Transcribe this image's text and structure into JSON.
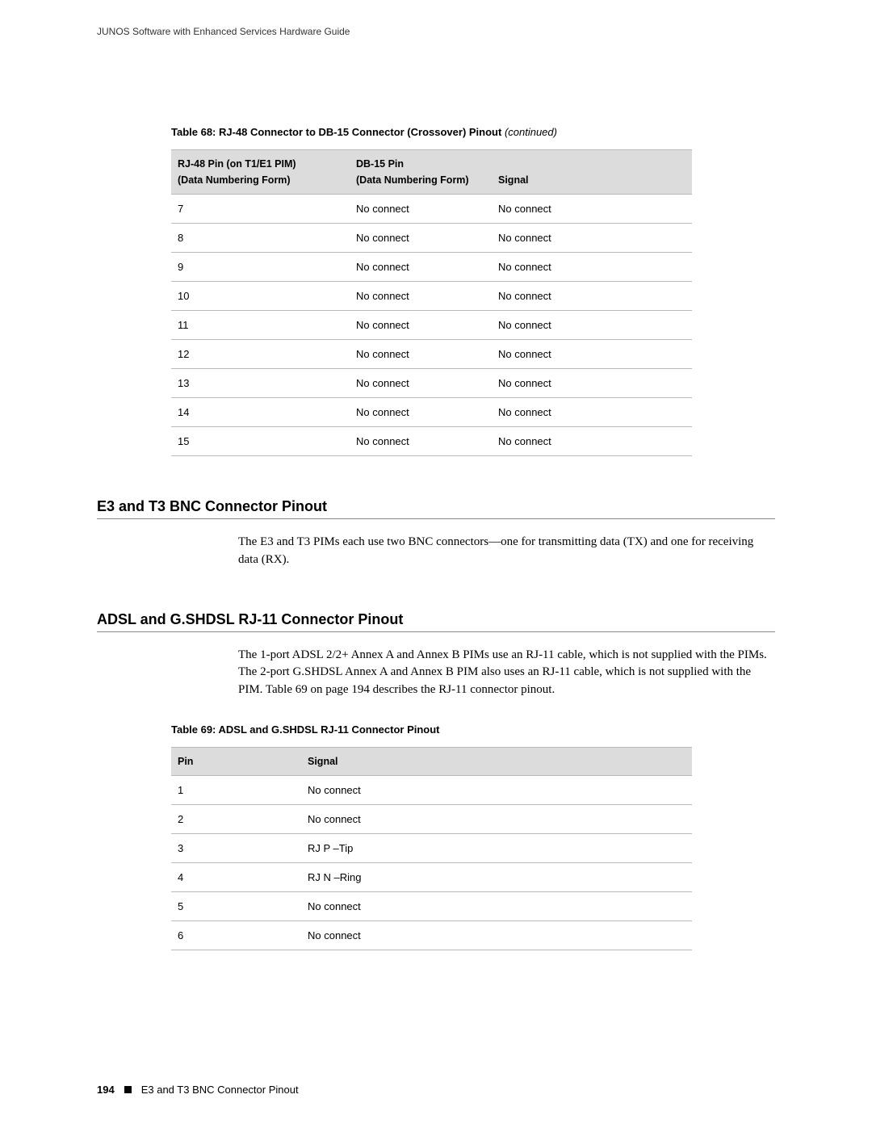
{
  "header": {
    "title": "JUNOS Software with Enhanced Services Hardware Guide"
  },
  "table68": {
    "caption_prefix": "Table 68: RJ-48 Connector to DB-15 Connector (Crossover) Pinout ",
    "caption_suffix": "(continued)",
    "headers": {
      "col1a": "RJ-48 Pin (on T1/E1 PIM)",
      "col1b": "(Data Numbering Form)",
      "col2a": "DB-15 Pin",
      "col2b": "(Data Numbering Form)",
      "col3": "Signal"
    },
    "rows": [
      {
        "c1": "7",
        "c2": "No connect",
        "c3": "No connect"
      },
      {
        "c1": "8",
        "c2": "No connect",
        "c3": "No connect"
      },
      {
        "c1": "9",
        "c2": "No connect",
        "c3": "No connect"
      },
      {
        "c1": "10",
        "c2": "No connect",
        "c3": "No connect"
      },
      {
        "c1": "11",
        "c2": "No connect",
        "c3": "No connect"
      },
      {
        "c1": "12",
        "c2": "No connect",
        "c3": "No connect"
      },
      {
        "c1": "13",
        "c2": "No connect",
        "c3": "No connect"
      },
      {
        "c1": "14",
        "c2": "No connect",
        "c3": "No connect"
      },
      {
        "c1": "15",
        "c2": "No connect",
        "c3": "No connect"
      }
    ]
  },
  "section1": {
    "heading": "E3 and T3 BNC Connector Pinout",
    "para": "The E3 and T3 PIMs each use two BNC connectors—one for transmitting data (TX) and one for receiving data (RX)."
  },
  "section2": {
    "heading": "ADSL and G.SHDSL RJ-11 Connector Pinout",
    "para": "The 1-port ADSL 2/2+ Annex A and Annex B PIMs use an RJ-11 cable, which is not supplied with the PIMs. The 2-port G.SHDSL Annex A and Annex B PIM also uses an RJ-11 cable, which is not supplied with the PIM. Table 69 on page 194 describes the RJ-11 connector pinout."
  },
  "table69": {
    "caption": "Table 69: ADSL and G.SHDSL RJ-11 Connector Pinout",
    "headers": {
      "col1": "Pin",
      "col2": "Signal"
    },
    "rows": [
      {
        "c1": "1",
        "c2": "No connect"
      },
      {
        "c1": "2",
        "c2": "No connect"
      },
      {
        "c1": "3",
        "c2": "RJ P –Tip"
      },
      {
        "c1": "4",
        "c2": "RJ N –Ring"
      },
      {
        "c1": "5",
        "c2": "No connect"
      },
      {
        "c1": "6",
        "c2": "No connect"
      }
    ]
  },
  "footer": {
    "page_number": "194",
    "section": "E3 and T3 BNC Connector Pinout"
  },
  "chart_data": [
    {
      "type": "table",
      "title": "Table 68: RJ-48 Connector to DB-15 Connector (Crossover) Pinout (continued)",
      "columns": [
        "RJ-48 Pin (on T1/E1 PIM) (Data Numbering Form)",
        "DB-15 Pin (Data Numbering Form)",
        "Signal"
      ],
      "rows": [
        [
          "7",
          "No connect",
          "No connect"
        ],
        [
          "8",
          "No connect",
          "No connect"
        ],
        [
          "9",
          "No connect",
          "No connect"
        ],
        [
          "10",
          "No connect",
          "No connect"
        ],
        [
          "11",
          "No connect",
          "No connect"
        ],
        [
          "12",
          "No connect",
          "No connect"
        ],
        [
          "13",
          "No connect",
          "No connect"
        ],
        [
          "14",
          "No connect",
          "No connect"
        ],
        [
          "15",
          "No connect",
          "No connect"
        ]
      ]
    },
    {
      "type": "table",
      "title": "Table 69: ADSL and G.SHDSL RJ-11 Connector Pinout",
      "columns": [
        "Pin",
        "Signal"
      ],
      "rows": [
        [
          "1",
          "No connect"
        ],
        [
          "2",
          "No connect"
        ],
        [
          "3",
          "RJ P –Tip"
        ],
        [
          "4",
          "RJ N –Ring"
        ],
        [
          "5",
          "No connect"
        ],
        [
          "6",
          "No connect"
        ]
      ]
    }
  ]
}
